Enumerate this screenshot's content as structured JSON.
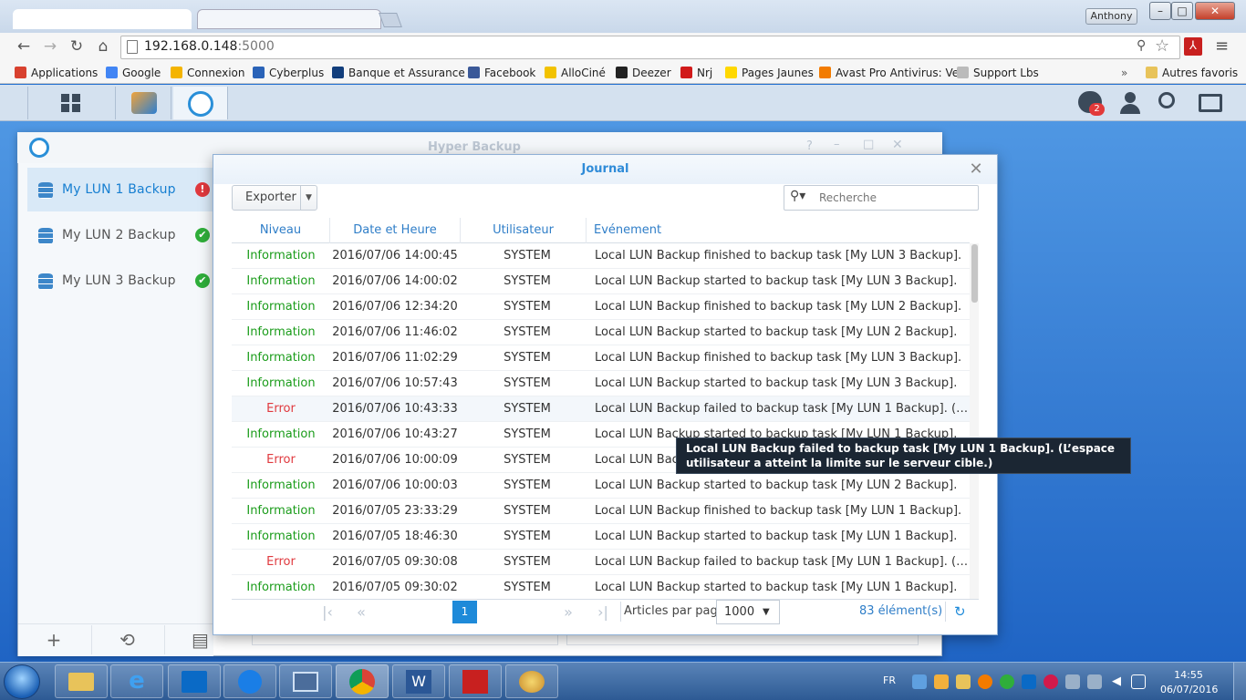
{
  "browser": {
    "window_user": "Anthony",
    "url_host": "192.168.0.148",
    "url_port": ":5000",
    "bookmarks": [
      {
        "label": "Applications",
        "color": "#d8412f"
      },
      {
        "label": "Google",
        "color": "#4285f4"
      },
      {
        "label": "Connexion",
        "color": "#f4b400"
      },
      {
        "label": "Cyberplus",
        "color": "#2a63b8"
      },
      {
        "label": "Banque et Assurance",
        "color": "#123e7c"
      },
      {
        "label": "Facebook",
        "color": "#3b5998"
      },
      {
        "label": "AlloCiné",
        "color": "#f2c200"
      },
      {
        "label": "Deezer",
        "color": "#222222"
      },
      {
        "label": "Nrj",
        "color": "#d11a1a"
      },
      {
        "label": "Pages Jaunes",
        "color": "#ffd800"
      },
      {
        "label": "Avast Pro Antivirus: Ve",
        "color": "#f27b00"
      },
      {
        "label": "Support Lbs",
        "color": "#bbbbbb"
      }
    ],
    "other_bookmarks": "Autres favoris",
    "overflow": "»"
  },
  "dsm": {
    "notifications_badge": "2"
  },
  "hyperbackup": {
    "title": "Hyper Backup",
    "tasks": [
      {
        "label": "My LUN 1 Backup",
        "status": "error",
        "status_glyph": "!"
      },
      {
        "label": "My LUN 2 Backup",
        "status": "ok",
        "status_glyph": "✔"
      },
      {
        "label": "My LUN 3 Backup",
        "status": "ok",
        "status_glyph": "✔"
      }
    ]
  },
  "journal": {
    "title": "Journal",
    "export_label": "Exporter",
    "search_placeholder": "Recherche",
    "columns": {
      "level": "Niveau",
      "datetime": "Date et Heure",
      "user": "Utilisateur",
      "event": "Evénement"
    },
    "rows": [
      {
        "level": "Information",
        "datetime": "2016/07/06 14:00:45",
        "user": "SYSTEM",
        "event": "Local LUN Backup finished to backup task [My LUN 3 Backup]."
      },
      {
        "level": "Information",
        "datetime": "2016/07/06 14:00:02",
        "user": "SYSTEM",
        "event": "Local LUN Backup started to backup task [My LUN 3 Backup]."
      },
      {
        "level": "Information",
        "datetime": "2016/07/06 12:34:20",
        "user": "SYSTEM",
        "event": "Local LUN Backup finished to backup task [My LUN 2 Backup]."
      },
      {
        "level": "Information",
        "datetime": "2016/07/06 11:46:02",
        "user": "SYSTEM",
        "event": "Local LUN Backup started to backup task [My LUN 2 Backup]."
      },
      {
        "level": "Information",
        "datetime": "2016/07/06 11:02:29",
        "user": "SYSTEM",
        "event": "Local LUN Backup finished to backup task [My LUN 3 Backup]."
      },
      {
        "level": "Information",
        "datetime": "2016/07/06 10:57:43",
        "user": "SYSTEM",
        "event": "Local LUN Backup started to backup task [My LUN 3 Backup]."
      },
      {
        "level": "Error",
        "datetime": "2016/07/06 10:43:33",
        "user": "SYSTEM",
        "event": "Local LUN Backup failed to backup task [My LUN 1 Backup]. (L’espa..."
      },
      {
        "level": "Information",
        "datetime": "2016/07/06 10:43:27",
        "user": "SYSTEM",
        "event": "Local LUN Backup started to backup task [My LUN 1 Backup]."
      },
      {
        "level": "Error",
        "datetime": "2016/07/06 10:00:09",
        "user": "SYSTEM",
        "event": "Local LUN Backup failed to backup task [My LUN 1 Backup]. (L’espa..."
      },
      {
        "level": "Information",
        "datetime": "2016/07/06 10:00:03",
        "user": "SYSTEM",
        "event": "Local LUN Backup started to backup task [My LUN 2 Backup]."
      },
      {
        "level": "Information",
        "datetime": "2016/07/05 23:33:29",
        "user": "SYSTEM",
        "event": "Local LUN Backup finished to backup task [My LUN 1 Backup]."
      },
      {
        "level": "Information",
        "datetime": "2016/07/05 18:46:30",
        "user": "SYSTEM",
        "event": "Local LUN Backup started to backup task [My LUN 1 Backup]."
      },
      {
        "level": "Error",
        "datetime": "2016/07/05 09:30:08",
        "user": "SYSTEM",
        "event": "Local LUN Backup failed to backup task [My LUN 1 Backup]. (L’espa..."
      },
      {
        "level": "Information",
        "datetime": "2016/07/05 09:30:02",
        "user": "SYSTEM",
        "event": "Local LUN Backup started to backup task [My LUN 1 Backup]."
      }
    ],
    "current_page": "1",
    "per_page_label": "Articles par page",
    "per_page_value": "1000",
    "item_count": "83 élément(s)",
    "tooltip": "Local LUN Backup failed to backup task [My LUN 1 Backup]. (L’espace utilisateur a atteint la limite sur le serveur cible.)"
  },
  "taskbar": {
    "language": "FR",
    "time": "14:55",
    "date": "06/07/2016"
  },
  "colors": {
    "info": "#1a9c1a",
    "error": "#e0393e",
    "accent": "#1e8ad9"
  }
}
